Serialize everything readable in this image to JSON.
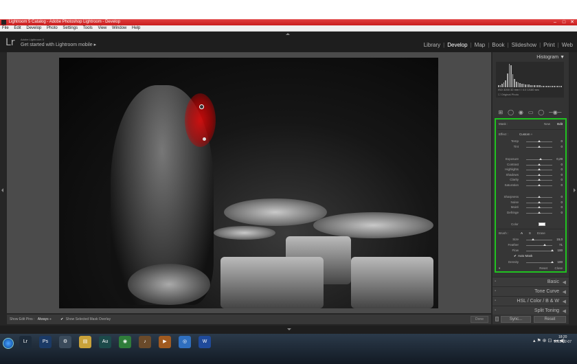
{
  "window": {
    "title": "Lightroom 5 Catalog - Adobe Photoshop Lightroom - Develop",
    "controls": [
      "–",
      "□",
      "✕"
    ]
  },
  "menu": [
    "File",
    "Edit",
    "Develop",
    "Photo",
    "Settings",
    "Tools",
    "View",
    "Window",
    "Help"
  ],
  "identity": {
    "logo": "Lr",
    "line1": "Adobe Lightroom 5",
    "line2": "Get started with Lightroom mobile  ▸"
  },
  "modules": [
    {
      "label": "Library",
      "active": false
    },
    {
      "label": "Develop",
      "active": true
    },
    {
      "label": "Map",
      "active": false
    },
    {
      "label": "Book",
      "active": false
    },
    {
      "label": "Slideshow",
      "active": false
    },
    {
      "label": "Print",
      "active": false
    },
    {
      "label": "Web",
      "active": false
    }
  ],
  "module_separator": "|",
  "histogram": {
    "title": "Histogram",
    "arrow": "▼",
    "info": "ISO 3200    32 mm    f / 4.0    1/160 sec",
    "original_photo": "Original Photo",
    "bins": [
      8,
      10,
      14,
      20,
      30,
      60,
      100,
      95,
      55,
      35,
      25,
      20,
      18,
      16,
      14,
      13,
      12,
      11,
      10,
      10,
      9,
      9,
      8,
      8,
      7,
      7,
      7,
      6,
      6,
      6,
      6,
      5,
      5,
      5,
      5,
      5
    ]
  },
  "tool_icons": [
    "⊞",
    "◯",
    "◉",
    "▭",
    "◯",
    "─◉─"
  ],
  "mask_panel": {
    "mask_label": "Mask :",
    "new_label": "New",
    "edit_label": "Edit",
    "effect_label": "Effect :",
    "effect_value": "Custom ÷",
    "sliders_top": [
      {
        "label": "Temp",
        "value": "0",
        "pos": 0.5
      },
      {
        "label": "Tint",
        "value": "0",
        "pos": 0.5
      }
    ],
    "sliders_mid": [
      {
        "label": "Exposure",
        "value": "0,29",
        "pos": 0.56
      },
      {
        "label": "Contrast",
        "value": "0",
        "pos": 0.5
      },
      {
        "label": "Highlights",
        "value": "0",
        "pos": 0.5
      },
      {
        "label": "Shadows",
        "value": "0",
        "pos": 0.5
      },
      {
        "label": "Clarity",
        "value": "0",
        "pos": 0.5
      },
      {
        "label": "Saturation",
        "value": "0",
        "pos": 0.5
      }
    ],
    "sliders_low": [
      {
        "label": "Sharpness",
        "value": "0",
        "pos": 0.5
      },
      {
        "label": "Noise",
        "value": "0",
        "pos": 0.5
      },
      {
        "label": "Moiré",
        "value": "0",
        "pos": 0.5
      },
      {
        "label": "Defringe",
        "value": "0",
        "pos": 0.5
      }
    ],
    "color_label": "Color",
    "brush_label": "Brush :",
    "brush_a": "A",
    "brush_b": "B",
    "erase_label": "Erase",
    "brush_sliders": [
      {
        "label": "Size",
        "value": "15,0",
        "pos": 0.25
      },
      {
        "label": "Feather",
        "value": "71",
        "pos": 0.71
      },
      {
        "label": "Flow",
        "value": "100",
        "pos": 1.0
      }
    ],
    "auto_mask_label": "Auto Mask",
    "auto_mask_checked": "✔",
    "density_label": "Density",
    "density_value": "100",
    "density_pos": 1.0,
    "reset_label": "Reset",
    "close_label": "Close"
  },
  "panels": [
    {
      "label": "Basic"
    },
    {
      "label": "Tone Curve"
    },
    {
      "label": "HSL  /  Color  /  B & W"
    },
    {
      "label": "Split Toning"
    }
  ],
  "panel_arrow": "◀",
  "toolbar": {
    "show_edit_pins_label": "Show Edit Pins :",
    "show_edit_pins_value": "Always ÷",
    "show_mask_overlay_label": "Show Selected Mask Overlay",
    "show_mask_overlay_checked": "✔",
    "done_label": "Done"
  },
  "sync": {
    "sync_label": "Sync...",
    "reset_label": "Reset"
  },
  "taskbar": {
    "items": [
      {
        "label": "Lr",
        "color": "#1d2b3a"
      },
      {
        "label": "Ps",
        "color": "#1b3a66"
      },
      {
        "label": "⚙",
        "color": "#3b4b5b"
      },
      {
        "label": "▤",
        "color": "#c9a23a"
      },
      {
        "label": "Au",
        "color": "#1c4a4a"
      },
      {
        "label": "◉",
        "color": "#2f7d3a"
      },
      {
        "label": "♪",
        "color": "#6a4a2a"
      },
      {
        "label": "▶",
        "color": "#a05a20"
      },
      {
        "label": "◎",
        "color": "#2f6fbf"
      },
      {
        "label": "W",
        "color": "#1f4a9a"
      }
    ],
    "tray": "▴  ⚑  ⊕  ⊡  ◂◂  ◀)",
    "time": "18:20",
    "date": "2015-02-07"
  },
  "colors": {
    "accent_green": "#20c320",
    "mask_red": "#d81010",
    "title_red": "#d22b2b"
  }
}
